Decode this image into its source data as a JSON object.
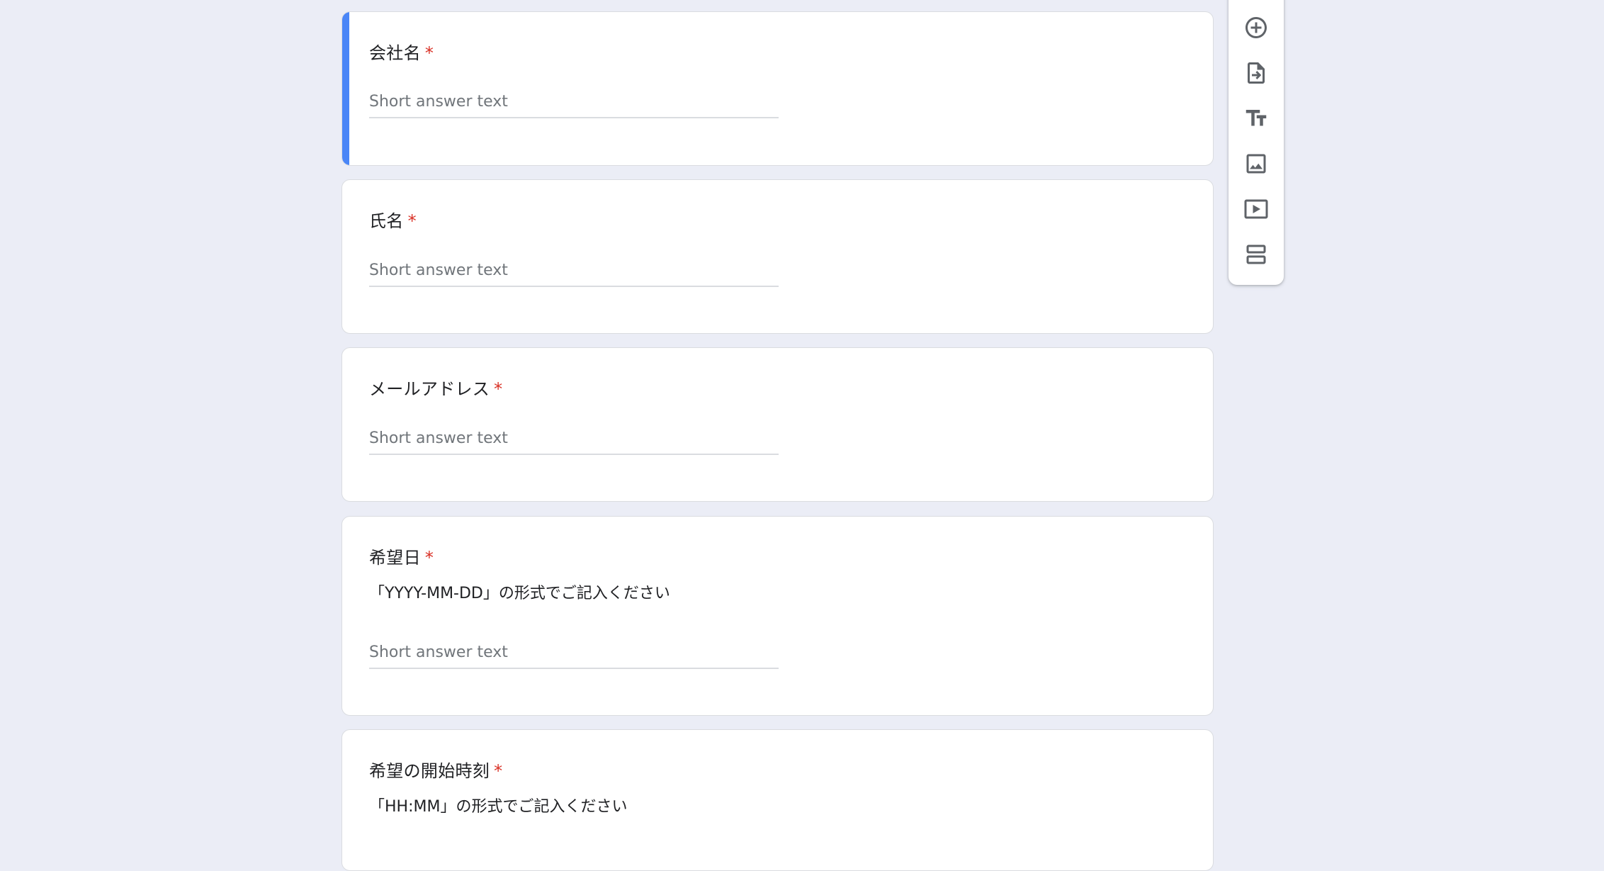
{
  "questions": [
    {
      "title": "会社名",
      "required": "*",
      "placeholder": "Short answer text"
    },
    {
      "title": "氏名",
      "required": "*",
      "placeholder": "Short answer text"
    },
    {
      "title": "メールアドレス",
      "required": "*",
      "placeholder": "Short answer text"
    },
    {
      "title": "希望日",
      "required": "*",
      "description": "「YYYY-MM-DD」の形式でご記入ください",
      "placeholder": "Short answer text"
    },
    {
      "title": "希望の開始時刻",
      "required": "*",
      "description": "「HH:MM」の形式でご記入ください"
    }
  ],
  "toolbar": {
    "icons": [
      "add-question-icon",
      "import-questions-icon",
      "add-title-icon",
      "add-image-icon",
      "add-video-icon",
      "add-section-icon"
    ]
  },
  "colors": {
    "accent": "#4a86f7",
    "required": "#d93025",
    "background": "#ebedf6"
  }
}
